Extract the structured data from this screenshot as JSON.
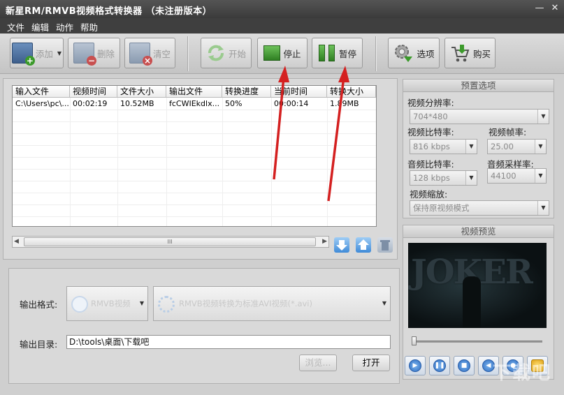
{
  "window": {
    "title": "新星RM/RMVB视频格式转换器 （未注册版本）"
  },
  "menu": [
    "文件",
    "编辑",
    "动作",
    "帮助"
  ],
  "toolbar": {
    "add": "添加",
    "delete": "删除",
    "clear": "清空",
    "start": "开始",
    "stop": "停止",
    "pause": "暂停",
    "options": "选项",
    "buy": "购买"
  },
  "filelist": {
    "columns": [
      "输入文件",
      "视频时间",
      "文件大小",
      "输出文件",
      "转换进度",
      "当前时间",
      "转换大小"
    ],
    "rows": [
      [
        "C:\\Users\\pc\\...",
        "00:02:19",
        "10.52MB",
        "fcCWIEkdlx...",
        "50%",
        "00:00:14",
        "1.89MB"
      ]
    ]
  },
  "scroll": {
    "thumb_label": "III"
  },
  "output": {
    "format_label": "输出格式:",
    "format_value": "RMVB视频",
    "profile_value": "RMVB视频转换为标准AVI视频(*.avi)",
    "dir_label": "输出目录:",
    "dir_value": "D:\\tools\\桌面\\下载吧",
    "browse": "浏览...",
    "open": "打开"
  },
  "preset": {
    "title": "预置选项",
    "resolution_label": "视频分辨率:",
    "resolution_value": "704*480",
    "video_bitrate_label": "视频比特率:",
    "video_bitrate_value": "816 kbps",
    "framerate_label": "视频帧率:",
    "framerate_value": "25.00",
    "audio_bitrate_label": "音频比特率:",
    "audio_bitrate_value": "128 kbps",
    "samplerate_label": "音频采样率:",
    "samplerate_value": "44100",
    "scale_label": "视频缩放:",
    "scale_value": "保持原视频模式"
  },
  "preview": {
    "title": "视频预览",
    "poster_text": "JOKER"
  },
  "watermark": "下载吧",
  "colors": {
    "arrow": "#d42020",
    "title_bg": "#3b3b3b",
    "accent_green": "#3c9a2b"
  }
}
